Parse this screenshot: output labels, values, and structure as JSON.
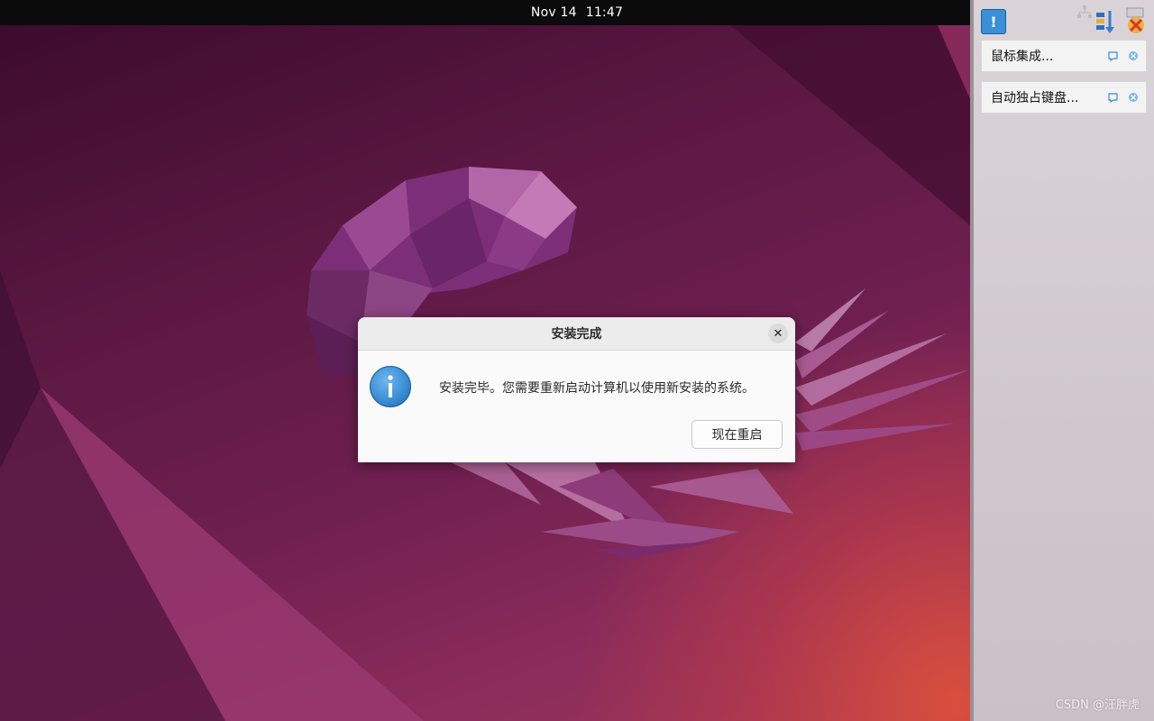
{
  "topbar": {
    "date": "Nov 14",
    "time": "11:47"
  },
  "side_panel": {
    "toolbar": {
      "message_icon": "notification-icon",
      "network_icon": "network-icon",
      "sort_icon": "sort-icon",
      "disconnect_icon": "disconnect-icon"
    },
    "notifications": [
      {
        "label": "鼠标集成..."
      },
      {
        "label": "自动独占键盘..."
      }
    ]
  },
  "dialog": {
    "title": "安装完成",
    "message": "安装完毕。您需要重新启动计算机以使用新安装的系统。",
    "restart_label": "现在重启",
    "close_glyph": "✕"
  },
  "watermark": "CSDN @汪胖虎",
  "colors": {
    "topbar": "#0b0b0b",
    "accent_blue": "#3a8fd6",
    "dialog_bg": "#fafafa"
  }
}
